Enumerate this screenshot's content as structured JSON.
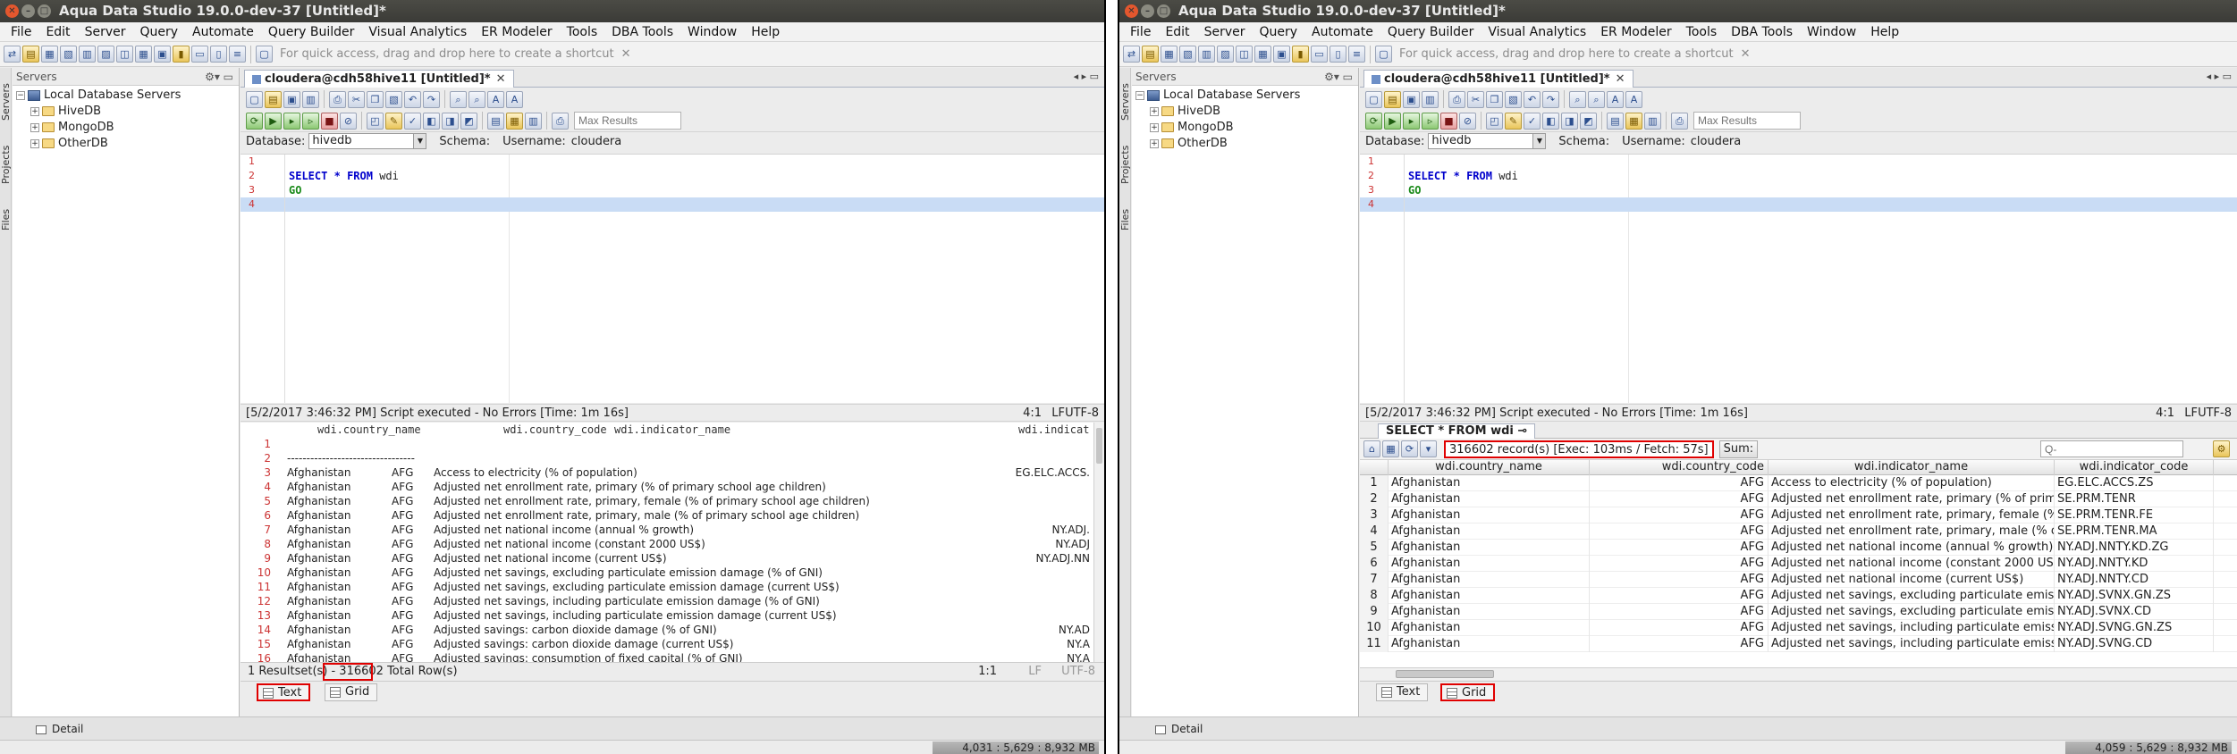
{
  "window": {
    "title": "Aqua Data Studio 19.0.0-dev-37 [Untitled]*"
  },
  "menu": [
    "File",
    "Edit",
    "Server",
    "Query",
    "Automate",
    "Query Builder",
    "Visual Analytics",
    "ER Modeler",
    "Tools",
    "DBA Tools",
    "Window",
    "Help"
  ],
  "toolbar": {
    "shortcut_hint": "For quick access, drag and drop here to create a shortcut"
  },
  "dock": {
    "servers": "Servers",
    "projects": "Projects",
    "files": "Files"
  },
  "servers_panel": {
    "header": "Servers",
    "root": "Local Database Servers",
    "items": [
      "HiveDB",
      "MongoDB",
      "OtherDB"
    ]
  },
  "editor": {
    "tab_label": "cloudera@cdh58hive11 [Untitled]*",
    "max_results_placeholder": "Max Results",
    "database_label": "Database:",
    "database_value": "hivedb",
    "schema_label": "Schema:",
    "username_label": "Username:",
    "username_value": "cloudera",
    "line_numbers": [
      "1",
      "2",
      "3",
      "4"
    ],
    "sql": {
      "select": "SELECT",
      "star": "*",
      "from": "FROM",
      "table": "wdi",
      "go": "GO"
    },
    "status": "[5/2/2017 3:46:32 PM] Script executed - No Errors [Time: 1m 16s]",
    "position": "4:1",
    "line_ending": "LF",
    "encoding": "UTF-8"
  },
  "left_results": {
    "headers": [
      "wdi.country_name",
      "wdi.country_code",
      "wdi.indicator_name",
      "wdi.indicato"
    ],
    "separator": "---------------------------",
    "rows": [
      {
        "n": "1",
        "name": "",
        "code": "",
        "indicator": "",
        "icode": ""
      },
      {
        "n": "2",
        "name": "---------------------------------",
        "code": "",
        "indicator": "",
        "icode": ""
      },
      {
        "n": "3",
        "name": "Afghanistan",
        "code": "AFG",
        "indicator": "Access to electricity (% of population)",
        "icode": "EG.ELC.ACCS."
      },
      {
        "n": "4",
        "name": "Afghanistan",
        "code": "AFG",
        "indicator": "Adjusted net enrollment rate, primary (% of primary school age children)",
        "icode": ""
      },
      {
        "n": "5",
        "name": "Afghanistan",
        "code": "AFG",
        "indicator": "Adjusted net enrollment rate, primary, female (% of primary school age children)",
        "icode": ""
      },
      {
        "n": "6",
        "name": "Afghanistan",
        "code": "AFG",
        "indicator": "Adjusted net enrollment rate, primary, male (% of primary school age children)",
        "icode": ""
      },
      {
        "n": "7",
        "name": "Afghanistan",
        "code": "AFG",
        "indicator": "Adjusted net national income (annual % growth)",
        "icode": "NY.ADJ."
      },
      {
        "n": "8",
        "name": "Afghanistan",
        "code": "AFG",
        "indicator": "Adjusted net national income (constant 2000 US$)",
        "icode": "NY.ADJ"
      },
      {
        "n": "9",
        "name": "Afghanistan",
        "code": "AFG",
        "indicator": "Adjusted net national income (current US$)",
        "icode": "NY.ADJ.NN"
      },
      {
        "n": "10",
        "name": "Afghanistan",
        "code": "AFG",
        "indicator": "Adjusted net savings, excluding particulate emission damage (% of GNI)",
        "icode": ""
      },
      {
        "n": "11",
        "name": "Afghanistan",
        "code": "AFG",
        "indicator": "Adjusted net savings, excluding particulate emission damage (current US$)",
        "icode": ""
      },
      {
        "n": "12",
        "name": "Afghanistan",
        "code": "AFG",
        "indicator": "Adjusted net savings, including particulate emission damage (% of GNI)",
        "icode": ""
      },
      {
        "n": "13",
        "name": "Afghanistan",
        "code": "AFG",
        "indicator": "Adjusted net savings, including particulate emission damage (current US$)",
        "icode": ""
      },
      {
        "n": "14",
        "name": "Afghanistan",
        "code": "AFG",
        "indicator": "Adjusted savings: carbon dioxide damage (% of GNI)",
        "icode": "NY.AD"
      },
      {
        "n": "15",
        "name": "Afghanistan",
        "code": "AFG",
        "indicator": "Adjusted savings: carbon dioxide damage (current US$)",
        "icode": "NY.A"
      },
      {
        "n": "16",
        "name": "Afghanistan",
        "code": "AFG",
        "indicator": "Adjusted savings: consumption of fixed capital (% of GNI)",
        "icode": "NY.A"
      }
    ],
    "footer": "1 Resultset(s) - 316602 Total Row(s)",
    "footer_pos": "1:1",
    "footer_le": "LF",
    "footer_enc": "UTF-8",
    "tabs": [
      "Text",
      "Grid"
    ]
  },
  "right_results": {
    "tab_label": "SELECT * FROM wdi",
    "record_count": "316602 record(s) [Exec: 103ms / Fetch: 57s]",
    "sum_label": "Sum:",
    "search_placeholder": "Q-",
    "headers": [
      "wdi.country_name",
      "wdi.country_code",
      "wdi.indicator_name",
      "wdi.indicator_code"
    ],
    "rows": [
      {
        "n": "1",
        "name": "Afghanistan",
        "code": "AFG",
        "indicator": "Access to electricity (% of population)",
        "icode": "EG.ELC.ACCS.ZS"
      },
      {
        "n": "2",
        "name": "Afghanistan",
        "code": "AFG",
        "indicator": "Adjusted net enrollment rate, primary (% of primary",
        "icode": "SE.PRM.TENR"
      },
      {
        "n": "3",
        "name": "Afghanistan",
        "code": "AFG",
        "indicator": "Adjusted net enrollment rate, primary, female (% of",
        "icode": "SE.PRM.TENR.FE"
      },
      {
        "n": "4",
        "name": "Afghanistan",
        "code": "AFG",
        "indicator": "Adjusted net enrollment rate, primary, male (% of pi",
        "icode": "SE.PRM.TENR.MA"
      },
      {
        "n": "5",
        "name": "Afghanistan",
        "code": "AFG",
        "indicator": "Adjusted net national income (annual % growth)",
        "icode": "NY.ADJ.NNTY.KD.ZG"
      },
      {
        "n": "6",
        "name": "Afghanistan",
        "code": "AFG",
        "indicator": "Adjusted net national income (constant 2000 US$)",
        "icode": "NY.ADJ.NNTY.KD"
      },
      {
        "n": "7",
        "name": "Afghanistan",
        "code": "AFG",
        "indicator": "Adjusted net national income (current US$)",
        "icode": "NY.ADJ.NNTY.CD"
      },
      {
        "n": "8",
        "name": "Afghanistan",
        "code": "AFG",
        "indicator": "Adjusted net savings, excluding particulate emission",
        "icode": "NY.ADJ.SVNX.GN.ZS"
      },
      {
        "n": "9",
        "name": "Afghanistan",
        "code": "AFG",
        "indicator": "Adjusted net savings, excluding particulate emission",
        "icode": "NY.ADJ.SVNX.CD"
      },
      {
        "n": "10",
        "name": "Afghanistan",
        "code": "AFG",
        "indicator": "Adjusted net savings, including particulate emission",
        "icode": "NY.ADJ.SVNG.GN.ZS"
      },
      {
        "n": "11",
        "name": "Afghanistan",
        "code": "AFG",
        "indicator": "Adjusted net savings, including particulate emission",
        "icode": "NY.ADJ.SVNG.CD"
      }
    ],
    "tabs": [
      "Text",
      "Grid"
    ]
  },
  "detail": {
    "label": "Detail"
  },
  "memory": {
    "left": "4,031 : 5,629 : 8,932 MB",
    "right": "4,059 : 5,629 : 8,932 MB"
  },
  "colors": {
    "titlebar": "#3b3b37",
    "highlight": "#e00000",
    "keyword": "#0000cc",
    "go": "#1a8a1a",
    "current_line": "#c9dcf5"
  }
}
